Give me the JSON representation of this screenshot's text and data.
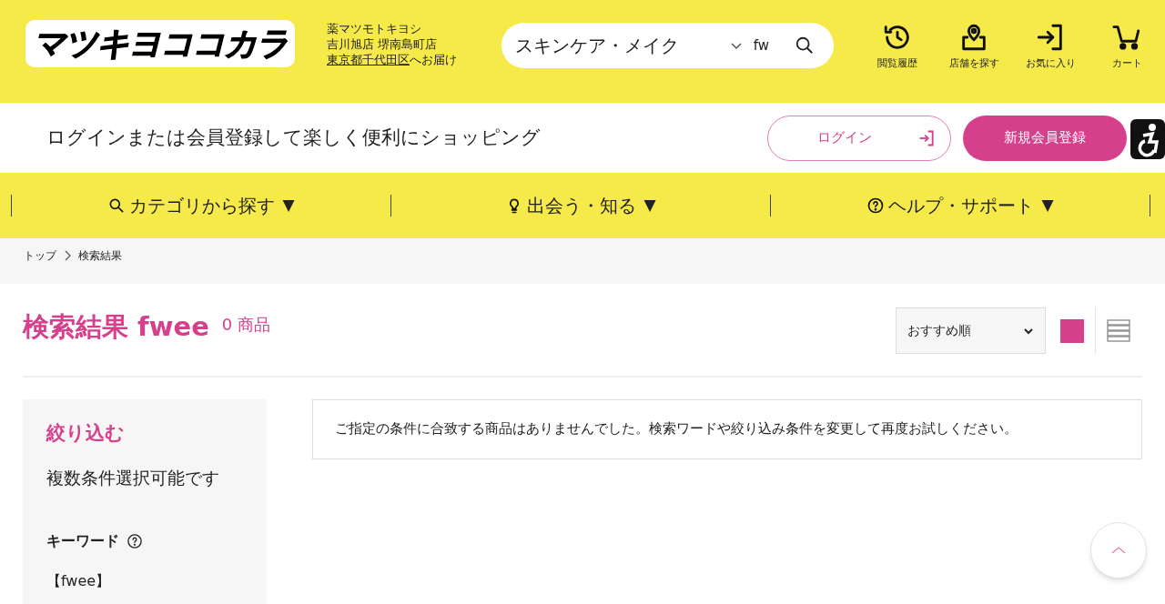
{
  "header": {
    "logo": "マツキヨココカラ",
    "store": {
      "line_1": "薬マツモトキヨシ",
      "line_2": "吉川旭店 堺南島町店",
      "delivery_link": "東京都千代田区",
      "delivery_suffix": "へお届け"
    },
    "search": {
      "category": "スキンケア・メイク",
      "value": "fw"
    },
    "icons": [
      {
        "kind": "history",
        "label": "閲覧履歴"
      },
      {
        "kind": "store",
        "label": "店舗を探す"
      },
      {
        "kind": "favorite",
        "label": "お気に入り"
      },
      {
        "kind": "cart",
        "label": "カート"
      }
    ]
  },
  "login_bar": {
    "message": "ログインまたは会員登録して楽しく便利にショッピング",
    "login_button": "ログイン",
    "register_button": "新規会員登録"
  },
  "nav": [
    {
      "kind": "search",
      "label": "カテゴリから探す",
      "caret": "▼"
    },
    {
      "kind": "bulb",
      "label": "出会う・知る",
      "caret": "▼"
    },
    {
      "kind": "help",
      "label": "ヘルプ・サポート",
      "caret": "▼"
    }
  ],
  "breadcrumb": [
    {
      "label": "トップ"
    },
    {
      "label": "検索結果"
    }
  ],
  "results": {
    "title": "検索結果 fwee",
    "count": "0 商品",
    "sort": "おすすめ順",
    "views": [
      {
        "kind": "grid",
        "selected": true
      },
      {
        "kind": "list",
        "selected": false
      }
    ],
    "empty_message": "ご指定の条件に合致する商品はありませんでした。検索ワードや絞り込み条件を変更して再度お試しください。"
  },
  "filter": {
    "title": "絞り込む",
    "note": "複数条件選択可能です",
    "keyword_label": "キーワード",
    "keyword_value": "【fwee】"
  }
}
